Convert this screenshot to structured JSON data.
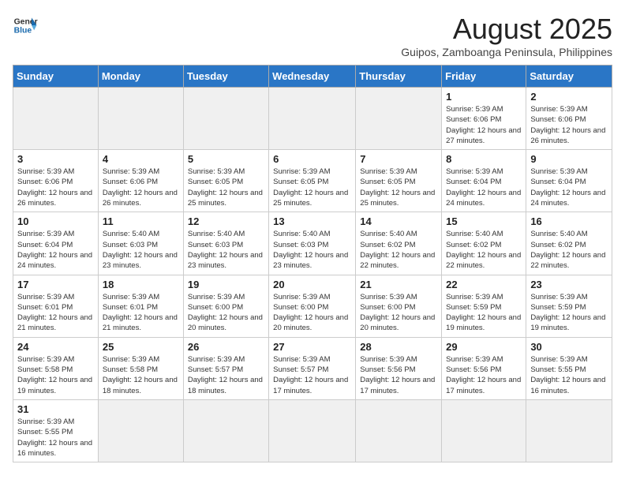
{
  "header": {
    "logo_general": "General",
    "logo_blue": "Blue",
    "month_year": "August 2025",
    "location": "Guipos, Zamboanga Peninsula, Philippines"
  },
  "weekdays": [
    "Sunday",
    "Monday",
    "Tuesday",
    "Wednesday",
    "Thursday",
    "Friday",
    "Saturday"
  ],
  "weeks": [
    [
      {
        "day": "",
        "info": ""
      },
      {
        "day": "",
        "info": ""
      },
      {
        "day": "",
        "info": ""
      },
      {
        "day": "",
        "info": ""
      },
      {
        "day": "",
        "info": ""
      },
      {
        "day": "1",
        "info": "Sunrise: 5:39 AM\nSunset: 6:06 PM\nDaylight: 12 hours and 27 minutes."
      },
      {
        "day": "2",
        "info": "Sunrise: 5:39 AM\nSunset: 6:06 PM\nDaylight: 12 hours and 26 minutes."
      }
    ],
    [
      {
        "day": "3",
        "info": "Sunrise: 5:39 AM\nSunset: 6:06 PM\nDaylight: 12 hours and 26 minutes."
      },
      {
        "day": "4",
        "info": "Sunrise: 5:39 AM\nSunset: 6:06 PM\nDaylight: 12 hours and 26 minutes."
      },
      {
        "day": "5",
        "info": "Sunrise: 5:39 AM\nSunset: 6:05 PM\nDaylight: 12 hours and 25 minutes."
      },
      {
        "day": "6",
        "info": "Sunrise: 5:39 AM\nSunset: 6:05 PM\nDaylight: 12 hours and 25 minutes."
      },
      {
        "day": "7",
        "info": "Sunrise: 5:39 AM\nSunset: 6:05 PM\nDaylight: 12 hours and 25 minutes."
      },
      {
        "day": "8",
        "info": "Sunrise: 5:39 AM\nSunset: 6:04 PM\nDaylight: 12 hours and 24 minutes."
      },
      {
        "day": "9",
        "info": "Sunrise: 5:39 AM\nSunset: 6:04 PM\nDaylight: 12 hours and 24 minutes."
      }
    ],
    [
      {
        "day": "10",
        "info": "Sunrise: 5:39 AM\nSunset: 6:04 PM\nDaylight: 12 hours and 24 minutes."
      },
      {
        "day": "11",
        "info": "Sunrise: 5:40 AM\nSunset: 6:03 PM\nDaylight: 12 hours and 23 minutes."
      },
      {
        "day": "12",
        "info": "Sunrise: 5:40 AM\nSunset: 6:03 PM\nDaylight: 12 hours and 23 minutes."
      },
      {
        "day": "13",
        "info": "Sunrise: 5:40 AM\nSunset: 6:03 PM\nDaylight: 12 hours and 23 minutes."
      },
      {
        "day": "14",
        "info": "Sunrise: 5:40 AM\nSunset: 6:02 PM\nDaylight: 12 hours and 22 minutes."
      },
      {
        "day": "15",
        "info": "Sunrise: 5:40 AM\nSunset: 6:02 PM\nDaylight: 12 hours and 22 minutes."
      },
      {
        "day": "16",
        "info": "Sunrise: 5:40 AM\nSunset: 6:02 PM\nDaylight: 12 hours and 22 minutes."
      }
    ],
    [
      {
        "day": "17",
        "info": "Sunrise: 5:39 AM\nSunset: 6:01 PM\nDaylight: 12 hours and 21 minutes."
      },
      {
        "day": "18",
        "info": "Sunrise: 5:39 AM\nSunset: 6:01 PM\nDaylight: 12 hours and 21 minutes."
      },
      {
        "day": "19",
        "info": "Sunrise: 5:39 AM\nSunset: 6:00 PM\nDaylight: 12 hours and 20 minutes."
      },
      {
        "day": "20",
        "info": "Sunrise: 5:39 AM\nSunset: 6:00 PM\nDaylight: 12 hours and 20 minutes."
      },
      {
        "day": "21",
        "info": "Sunrise: 5:39 AM\nSunset: 6:00 PM\nDaylight: 12 hours and 20 minutes."
      },
      {
        "day": "22",
        "info": "Sunrise: 5:39 AM\nSunset: 5:59 PM\nDaylight: 12 hours and 19 minutes."
      },
      {
        "day": "23",
        "info": "Sunrise: 5:39 AM\nSunset: 5:59 PM\nDaylight: 12 hours and 19 minutes."
      }
    ],
    [
      {
        "day": "24",
        "info": "Sunrise: 5:39 AM\nSunset: 5:58 PM\nDaylight: 12 hours and 19 minutes."
      },
      {
        "day": "25",
        "info": "Sunrise: 5:39 AM\nSunset: 5:58 PM\nDaylight: 12 hours and 18 minutes."
      },
      {
        "day": "26",
        "info": "Sunrise: 5:39 AM\nSunset: 5:57 PM\nDaylight: 12 hours and 18 minutes."
      },
      {
        "day": "27",
        "info": "Sunrise: 5:39 AM\nSunset: 5:57 PM\nDaylight: 12 hours and 17 minutes."
      },
      {
        "day": "28",
        "info": "Sunrise: 5:39 AM\nSunset: 5:56 PM\nDaylight: 12 hours and 17 minutes."
      },
      {
        "day": "29",
        "info": "Sunrise: 5:39 AM\nSunset: 5:56 PM\nDaylight: 12 hours and 17 minutes."
      },
      {
        "day": "30",
        "info": "Sunrise: 5:39 AM\nSunset: 5:55 PM\nDaylight: 12 hours and 16 minutes."
      }
    ],
    [
      {
        "day": "31",
        "info": "Sunrise: 5:39 AM\nSunset: 5:55 PM\nDaylight: 12 hours and 16 minutes."
      },
      {
        "day": "",
        "info": ""
      },
      {
        "day": "",
        "info": ""
      },
      {
        "day": "",
        "info": ""
      },
      {
        "day": "",
        "info": ""
      },
      {
        "day": "",
        "info": ""
      },
      {
        "day": "",
        "info": ""
      }
    ]
  ]
}
